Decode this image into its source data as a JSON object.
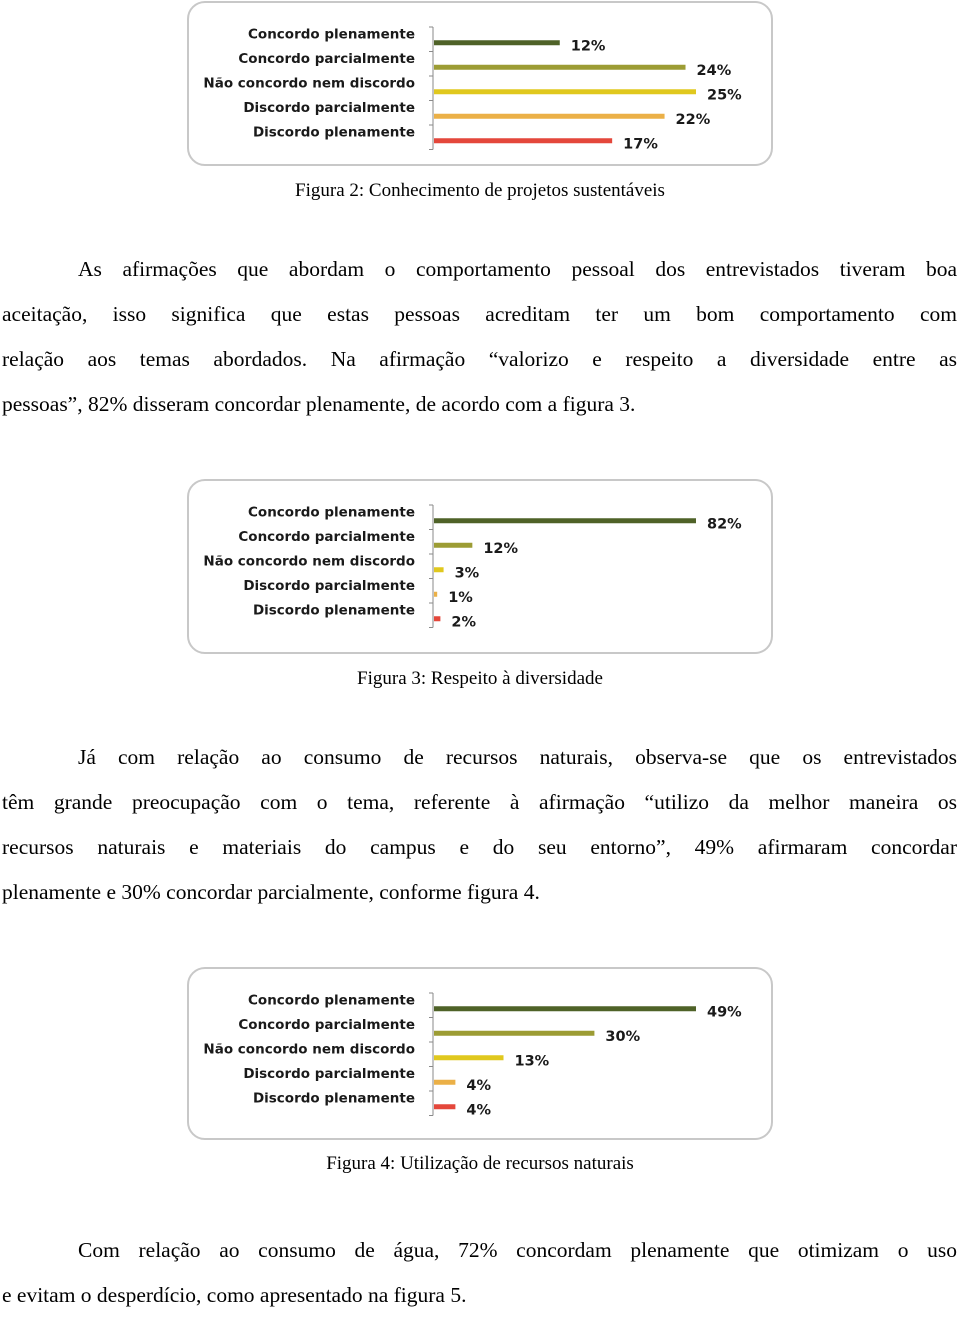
{
  "chart_data": [
    {
      "type": "bar",
      "orientation": "horizontal",
      "categories": [
        "Concordo plenamente",
        "Concordo parcialmente",
        "Não concordo nem discordo",
        "Discordo parcialmente",
        "Discordo plenamente"
      ],
      "values": [
        12,
        24,
        25,
        22,
        17
      ],
      "value_labels": [
        "12%",
        "24%",
        "25%",
        "22%",
        "17%"
      ],
      "colors": [
        "#4f6228",
        "#9c9c34",
        "#e0c81e",
        "#ebb047",
        "#e4473b"
      ],
      "title": "",
      "xlabel": "",
      "ylabel": "",
      "grid": false,
      "legend": "none"
    },
    {
      "type": "bar",
      "orientation": "horizontal",
      "categories": [
        "Concordo plenamente",
        "Concordo parcialmente",
        "Não concordo nem discordo",
        "Discordo parcialmente",
        "Discordo plenamente"
      ],
      "values": [
        82,
        12,
        3,
        1,
        2
      ],
      "value_labels": [
        "82%",
        "12%",
        "3%",
        "1%",
        "2%"
      ],
      "colors": [
        "#4f6228",
        "#9c9c34",
        "#e0c81e",
        "#ebb047",
        "#e4473b"
      ],
      "title": "",
      "xlabel": "",
      "ylabel": "",
      "grid": false,
      "legend": "none"
    },
    {
      "type": "bar",
      "orientation": "horizontal",
      "categories": [
        "Concordo plenamente",
        "Concordo parcialmente",
        "Não concordo nem discordo",
        "Discordo parcialmente",
        "Discordo plenamente"
      ],
      "values": [
        49,
        30,
        13,
        4,
        4
      ],
      "value_labels": [
        "49%",
        "30%",
        "13%",
        "4%",
        "4%"
      ],
      "colors": [
        "#4f6228",
        "#9c9c34",
        "#e0c81e",
        "#ebb047",
        "#e4473b"
      ],
      "title": "",
      "xlabel": "",
      "ylabel": "",
      "grid": false,
      "legend": "none"
    }
  ],
  "captions": [
    "Figura 2: Conhecimento de projetos sustentáveis",
    "Figura 3: Respeito à diversidade",
    "Figura 4: Utilização de recursos naturais"
  ],
  "paragraphs": [
    {
      "lines": [
        "As afirmações que abordam o comportamento pessoal dos entrevistados tiveram boa",
        "aceitação, isso significa que estas pessoas acreditam ter um bom comportamento com",
        "relação aos temas abordados. Na afirmação “valorizo e respeito a diversidade entre as",
        "pessoas”, 82% disseram concordar plenamente, de acordo com a figura 3."
      ]
    },
    {
      "lines": [
        "Já com relação ao consumo de recursos naturais, observa-se que os entrevistados",
        "têm grande preocupação com o tema, referente à afirmação “utilizo da melhor maneira os",
        "recursos naturais e materiais do campus e do seu entorno”, 49% afirmaram concordar",
        "plenamente e 30% concordar parcialmente, conforme figura 4."
      ]
    },
    {
      "lines": [
        "Com relação ao consumo de água, 72% concordam plenamente que otimizam o uso",
        "e evitam o desperdício, como apresentado na figura 5."
      ]
    }
  ]
}
